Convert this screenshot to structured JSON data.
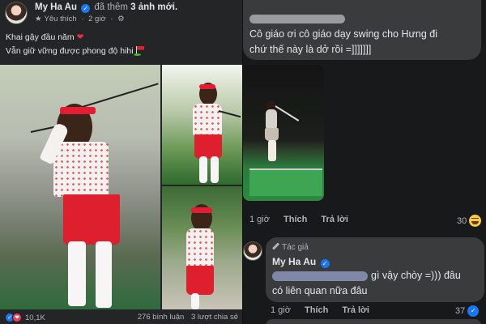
{
  "post": {
    "author": "My Ha Au",
    "action_prefix": "đã thêm",
    "action_bold": "3 ảnh mới.",
    "meta_star": "★",
    "meta_label": "Yêu thích",
    "meta_dot": "·",
    "meta_time": "2 giờ",
    "meta_privacy": "⚙",
    "caption_line1": "Khai gậy đầu năm",
    "caption_heart": "❤",
    "caption_line2": "Vẫn giữ vững được phong độ hihi",
    "reactions_count": "10,1K",
    "comments": "276 bình luận",
    "shares": "3 lượt chia sẻ",
    "verified_mark": "✓"
  },
  "thread": {
    "comment1_text_line1": "Cô giáo ơi cô giáo dạy swing cho Hưng đi",
    "comment1_text_line2": "chứ thế này là dở rồi =]]]]]]]",
    "comment1_time": "1 giờ",
    "comment1_like": "Thích",
    "comment1_reply": "Trả lời",
    "comment1_count": "30",
    "author_badge": "Tác giả",
    "reply_author": "My Ha Au",
    "reply_text_a": "gì vậy chòy =))) đâu",
    "reply_text_b": "có liên quan nữa đâu",
    "reply_time": "1 giờ",
    "reply_like": "Thích",
    "reply_reply": "Trả lời",
    "reply_count": "37",
    "like_glyph": "👍"
  },
  "colors": {
    "background": "#242526",
    "bubble": "#3a3b3c",
    "text": "#e4e6eb",
    "secondary_text": "#b0b3b8",
    "facebook_blue": "#1877f2",
    "love_red": "#f33e58"
  },
  "icons": [
    "avatar",
    "verified-badge-icon",
    "star-icon",
    "privacy-icon",
    "heart-emoji",
    "golf-flag-emoji",
    "like-reaction-icon",
    "love-reaction-icon",
    "haha-emoji-icon",
    "pen-icon",
    "thumbs-up-icon"
  ]
}
